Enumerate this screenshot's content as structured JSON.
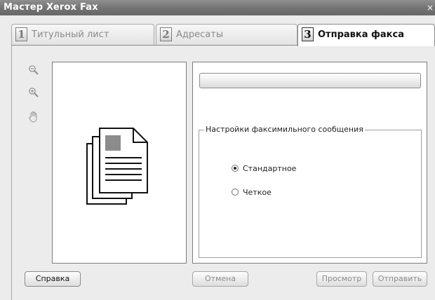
{
  "window": {
    "title": "Мастер Xerox Fax",
    "close_glyph": "×"
  },
  "tabs": [
    {
      "number": "1",
      "label": "Титульный лист",
      "active": false
    },
    {
      "number": "2",
      "label": "Адресаты",
      "active": false
    },
    {
      "number": "3",
      "label": "Отправка факса",
      "active": true
    }
  ],
  "toolbar": {
    "icons": [
      "zoom-out-icon",
      "zoom-in-icon",
      "pan-hand-icon"
    ],
    "zoom_out_glyph": "⊖",
    "zoom_in_glyph": "⊕",
    "pan_glyph": "✋"
  },
  "preview": {
    "icon": "multi-page-document-icon"
  },
  "send": {
    "progress_fraction": 0
  },
  "settings": {
    "group_label": "Настройки факсимильного сообщения",
    "options": [
      {
        "label": "Стандартное",
        "selected": true
      },
      {
        "label": "Четкое",
        "selected": false
      }
    ]
  },
  "buttons": {
    "help": "Справка",
    "cancel": "Отмена",
    "preview": "Просмотр",
    "send": "Отправить"
  },
  "colors": {
    "titlebar": "#727272",
    "panel_bg": "#ececec",
    "page_gray": "#8c8c8c"
  }
}
